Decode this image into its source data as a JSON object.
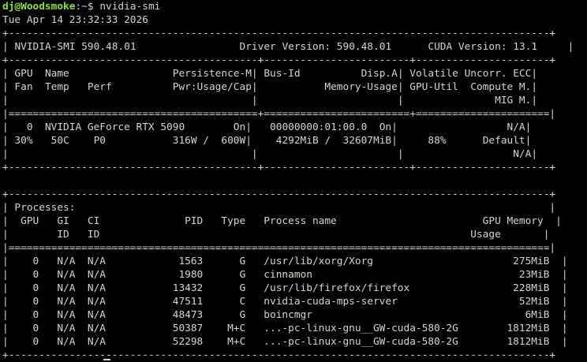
{
  "prompt": {
    "user_host": "dj@Woodsmoke",
    "separator": ":",
    "path": "~",
    "symbol": "$ ",
    "command": "nvidia-smi"
  },
  "timestamp": "Tue Apr 14 23:32:33 2026",
  "header": {
    "smi_version": "NVIDIA-SMI 590.48.01",
    "driver_version": "Driver Version: 590.48.01",
    "cuda_version": "CUDA Version: 13.1"
  },
  "gpu_table": {
    "header_rows": [
      {
        "c1": " GPU  Name                 Persistence-M",
        "c2": " Bus-Id          Disp.A",
        "c3": " Volatile Uncorr. ECC"
      },
      {
        "c1": " Fan  Temp   Perf          Pwr:Usage/Cap",
        "c2": "           Memory-Usage",
        "c3": " GPU-Util  Compute M."
      },
      {
        "c1": "                                        ",
        "c2": "                       ",
        "c3": "               MIG M."
      }
    ],
    "gpus": [
      {
        "row1": {
          "c1": "   0  NVIDIA GeForce RTX 5090        On",
          "c2": "   00000000:01:00.0  On",
          "c3": "                  N/A"
        },
        "row2": {
          "c1": " 30%   50C    P0           316W /  600W",
          "c2": "    4292MiB /  32607MiB",
          "c3": "     88%      Default"
        },
        "row3": {
          "c1": "                                        ",
          "c2": "                       ",
          "c3": "                  N/A"
        }
      }
    ]
  },
  "processes": {
    "title": " Processes:",
    "header_line1": "  GPU   GI   CI              PID   Type   Process name                        GPU Memory",
    "header_line2": "        ID   ID                                                             Usage",
    "rows": [
      "    0   N/A  N/A            1563      G   /usr/lib/xorg/Xorg                       275MiB",
      "    0   N/A  N/A            1980      G   cinnamon                                  23MiB",
      "    0   N/A  N/A           13432      G   /usr/lib/firefox/firefox                 228MiB",
      "    0   N/A  N/A           47511      C   nvidia-cuda-mps-server                    52MiB",
      "    0   N/A  N/A           48473      G   boincmgr                                   6MiB",
      "    0   N/A  N/A           50387    M+C   ...-pc-linux-gnu__GW-cuda-580-2G        1812MiB",
      "    0   N/A  N/A           52298    M+C   ...-pc-linux-gnu__GW-cuda-580-2G        1812MiB"
    ]
  },
  "borders": {
    "top": "+-----------------------------------------------------------------------------------------+",
    "gpu_sep_dash": "+-----------------------------------------+------------------------+----------------------+",
    "gpu_sep_equal": "|=========================================+========================+======================|",
    "gpu_bottom": "+-----------------------------------------+------------------------+----------------------+",
    "proc_top": "+-----------------------------------------------------------------------------------------+",
    "proc_equal": "|=========================================================================================|",
    "proc_bottom": "+-----------------------------------------------------------------------------------------+",
    "pipe": "|"
  },
  "colors": {
    "background": "#000000",
    "text": "#d3d7cf",
    "prompt_user": "#8ae234",
    "prompt_path": "#729fcf"
  }
}
